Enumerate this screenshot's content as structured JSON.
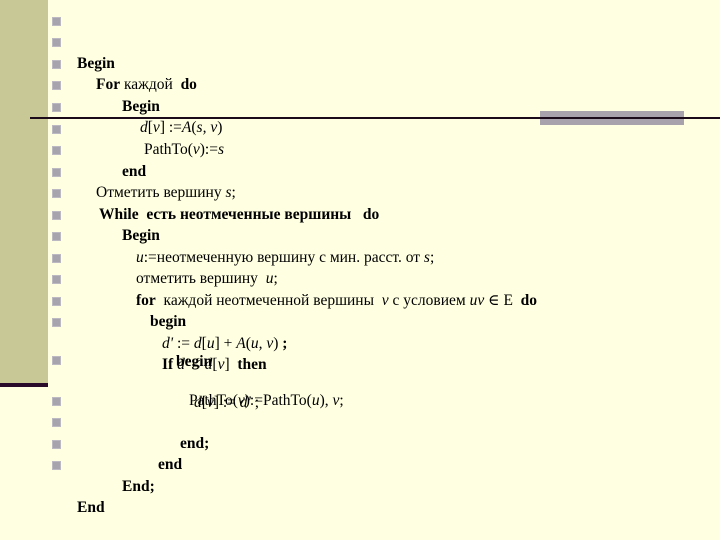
{
  "slide": {
    "colors": {
      "background": "#ffffe1",
      "side_band": "#c8c896",
      "rule": "#1a0a1a",
      "accent": "#a8a2ac",
      "bullet": "#a8a4ae"
    },
    "lines": [
      {
        "bullet": true,
        "text": "Begin"
      },
      {
        "bullet": true,
        "text": "For каждой  do"
      },
      {
        "bullet": true,
        "text": "Begin"
      },
      {
        "bullet": true,
        "text": "d[v] :=A(s, v)"
      },
      {
        "bullet": true,
        "text": "PathTo(v):=s"
      },
      {
        "bullet": true,
        "text": "end"
      },
      {
        "bullet": true,
        "text": "Отметить вершину s;"
      },
      {
        "bullet": true,
        "text": "While  есть неотмеченные вершины   do"
      },
      {
        "bullet": true,
        "text": "Begin"
      },
      {
        "bullet": true,
        "text": "u:=неотмеченную вершину с мин. расст. от s;"
      },
      {
        "bullet": true,
        "text": "отметить вершину  u;"
      },
      {
        "bullet": true,
        "text": "for  каждой неотмеченной вершины  v с условием uv ∈ E  do"
      },
      {
        "bullet": true,
        "text": "begin"
      },
      {
        "bullet": true,
        "text": "d' := d[u] + A(u, v) ;"
      },
      {
        "bullet": true,
        "text": "If d' < d[v]  then"
      },
      {
        "bullet": false,
        "text": "begin"
      },
      {
        "bullet": true,
        "text": "d[v] := d' ;"
      },
      {
        "bullet": false,
        "text": "PathTo(v):=PathTo(u), v;"
      },
      {
        "bullet": true,
        "text": "end;"
      },
      {
        "bullet": true,
        "text": "end"
      },
      {
        "bullet": true,
        "text": "End;"
      },
      {
        "bullet": true,
        "text": "End"
      }
    ],
    "parts": {
      "l0": {
        "kw": "Begin"
      },
      "l1": {
        "kw1": "For",
        "t": " каждой  ",
        "kw2": "do"
      },
      "l2": {
        "kw": "Begin"
      },
      "l3": {
        "a": "d",
        "b": "[",
        "c": "v",
        "d": "] :=",
        "e": "A",
        "f": "(",
        "g": "s, v",
        "h": ")"
      },
      "l4": {
        "a": "PathTo(",
        "b": "v",
        "c": "):=",
        "d": "s"
      },
      "l5": {
        "kw": "end"
      },
      "l6": {
        "a": "Отметить вершину ",
        "b": "s",
        "c": ";"
      },
      "l7": {
        "kw": "While  есть неотмеченные вершины   do"
      },
      "l8": {
        "kw": "Begin"
      },
      "l9": {
        "a": "u",
        "b": ":=неотмеченную вершину с мин. расст. от ",
        "c": "s",
        "d": ";"
      },
      "l10": {
        "a": "отметить вершину  ",
        "b": "u",
        "c": ";"
      },
      "l11": {
        "kw1": "for",
        "a": "  каждой неотмеченной вершины  ",
        "b": "v",
        "c": " с условием ",
        "d": "uv",
        "e": " ∈ E  ",
        "kw2": "do"
      },
      "l12": {
        "kw": "begin"
      },
      "l13": {
        "a": "d'",
        "b": " := ",
        "c": "d",
        "d": "[",
        "e": "u",
        "f": "] + ",
        "g": "A",
        "h": "(",
        "i": "u, v",
        "j": ") ",
        "kw": ";"
      },
      "l14": {
        "kw1": "If ",
        "a": "d'",
        "b": " < ",
        "c": "d",
        "d": "[",
        "e": "v",
        "f": "]  ",
        "kw2": "then"
      },
      "l15": {
        "kw": "begin"
      },
      "l16": {
        "a": "d",
        "b": "[",
        "c": "v",
        "d": "] := ",
        "e": "d'",
        "f": " ;"
      },
      "l17": {
        "a": "PathTo(",
        "b": "v",
        "c": "):=PathTo(",
        "d": "u",
        "e": "), ",
        "f": "v",
        "g": ";"
      },
      "l18": {
        "kw": "end;"
      },
      "l19": {
        "kw": "end"
      },
      "l20": {
        "kw": "End;"
      },
      "l21": {
        "kw": "End"
      }
    }
  }
}
